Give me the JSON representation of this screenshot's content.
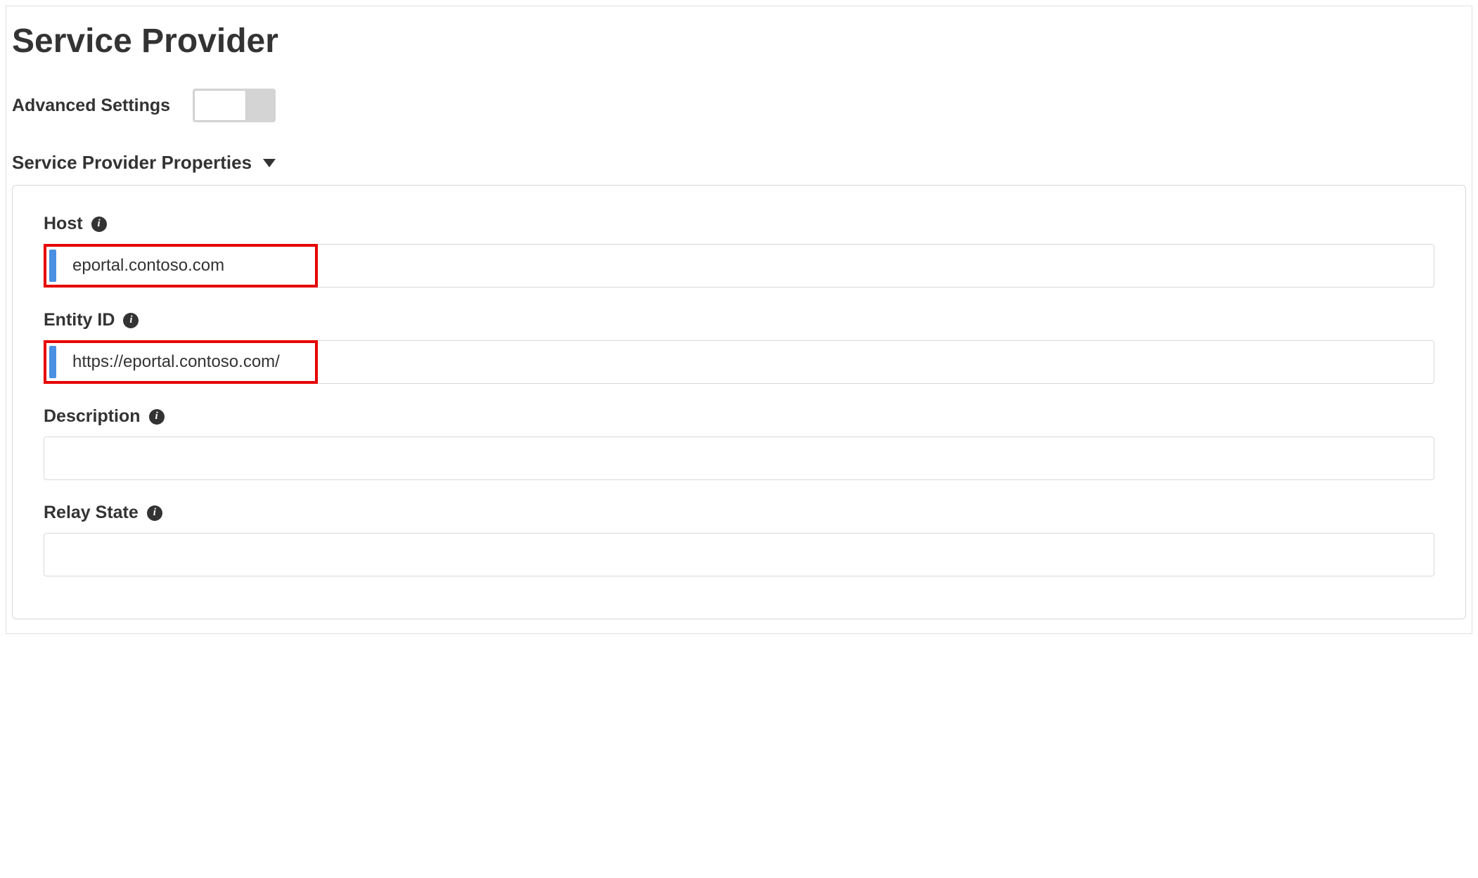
{
  "page": {
    "title": "Service Provider"
  },
  "advanced": {
    "label": "Advanced Settings",
    "enabled": false
  },
  "section": {
    "title": "Service Provider Properties"
  },
  "fields": {
    "host": {
      "label": "Host",
      "value": "eportal.contoso.com",
      "highlighted": true
    },
    "entityId": {
      "label": "Entity ID",
      "value": "https://eportal.contoso.com/",
      "highlighted": true
    },
    "description": {
      "label": "Description",
      "value": "",
      "highlighted": false
    },
    "relayState": {
      "label": "Relay State",
      "value": "",
      "highlighted": false
    }
  }
}
